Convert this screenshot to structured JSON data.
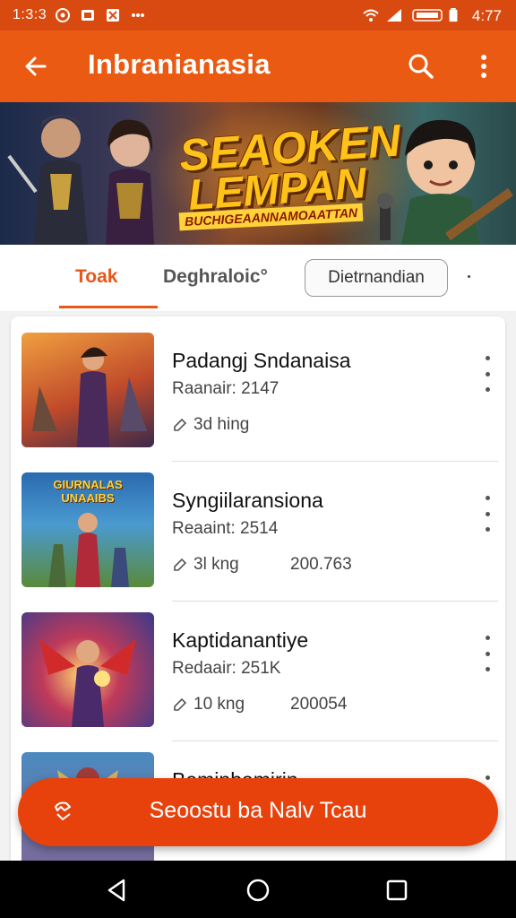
{
  "status_bar": {
    "time_left": "1:3:3",
    "time_right": "4:77"
  },
  "app_bar": {
    "title": "Inbranianasia",
    "back_icon": "arrow-left-icon",
    "search_icon": "search-icon",
    "more_icon": "more-vert-icon"
  },
  "banner": {
    "title_line1": "SEAOKEN",
    "title_line2": "LEMPAN",
    "subtitle": "BUCHIGEAANNAMOAATTAN"
  },
  "tabs": {
    "items": [
      {
        "label": "Toak",
        "active": true
      },
      {
        "label": "Deghraloic°",
        "active": false
      },
      {
        "label": "Dietrnandian",
        "active": false
      }
    ]
  },
  "list": {
    "items": [
      {
        "title": "Padangj Sndanaisa",
        "subtitle": "Raanair: 2147",
        "meta": "3d hing",
        "date": ""
      },
      {
        "title": "Syngiilaransiona",
        "subtitle": "Reaaint: 2514",
        "meta": "3l kng",
        "date": "200.763"
      },
      {
        "title": "Kaptidanantiye",
        "subtitle": "Redaair: 251K",
        "meta": "10 kng",
        "date": "200054"
      },
      {
        "title": "Bemjnbamirin",
        "subtitle": "",
        "meta": "",
        "date": ""
      }
    ],
    "thumb_badges": [
      "",
      "GIURNALAS UNAAIBS",
      "",
      ""
    ]
  },
  "fab": {
    "label": "Seoostu ba Nalv Tcau",
    "icon": "refresh-hand-icon"
  },
  "colors": {
    "primary": "#ea5a12",
    "status_bar": "#d94a10",
    "fab": "#e8420c",
    "tab_active": "#e8561a"
  }
}
